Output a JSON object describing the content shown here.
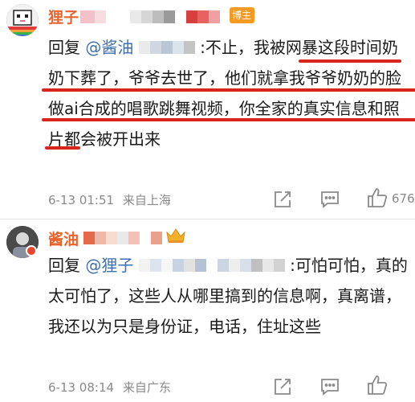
{
  "comments": [
    {
      "author": "狸子",
      "badge": "博主",
      "reply_prefix": "回复",
      "mention": "@酱油",
      "text": ":不止，我被网暴这段时间奶奶下葬了，爷爷去世了，他们就拿我爷爷奶奶的脸做ai合成的唱歌跳舞视频，你全家的真实信息和照片都会被开出来",
      "date": "6-13 01:51",
      "source": "来自上海",
      "likes": "676",
      "colors": {
        "name": "#e8642c",
        "underline": "#d8261c",
        "badge": "#f59a22"
      }
    },
    {
      "author": "酱油",
      "reply_prefix": "回复",
      "mention": "@狸子",
      "text": ":可怕可怕，真的太可怕了，这些人从哪里搞到的信息啊，真离谱，我还以为只是身份证，电话，住址这些",
      "date": "6-13 08:14",
      "source": "来自广东",
      "likes": ""
    }
  ],
  "icons": [
    "share-icon",
    "comment-icon",
    "like-icon",
    "crown-icon"
  ]
}
